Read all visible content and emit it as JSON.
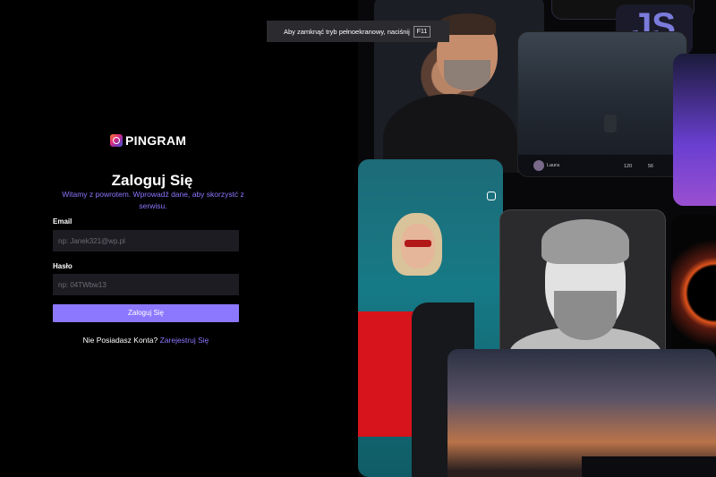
{
  "brand": {
    "name": "PINGRAM"
  },
  "login": {
    "title": "Zaloguj Się",
    "subtitle": "Witamy z powrotem. Wprowadź dane, aby skorzystć z serwisu.",
    "email_label": "Email",
    "email_placeholder": "np: Janek321@wp.pl",
    "password_label": "Hasło",
    "password_placeholder": "np: 04TWbw13",
    "submit_label": "Zaloguj Się",
    "signup_prompt": "Nie Posiadasz Konta?",
    "signup_link": "Zarejestruj Się"
  },
  "fullscreen_notice": {
    "text": "Aby zamknąć tryb pełnoekranowy, naciśnij",
    "key": "F11"
  },
  "collage": {
    "post_user": "Laura",
    "post_likes": "120",
    "post_comments": "56",
    "badge_text": "JS"
  },
  "colors": {
    "accent": "#8b78ff",
    "background": "#000000",
    "input_bg": "#1c1c22"
  }
}
